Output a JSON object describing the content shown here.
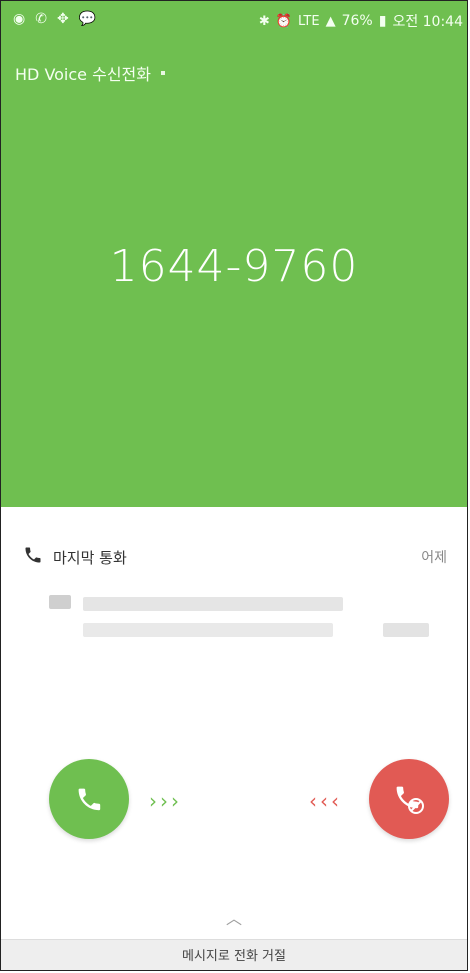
{
  "status_bar": {
    "left_icons": [
      "app-icon",
      "phone-call-icon",
      "location-icon",
      "chat-icon"
    ],
    "bluetooth": "✱",
    "alarm": "⏰",
    "network": "LTE",
    "signal": "▲",
    "battery": "76%",
    "time": "오전 10:44"
  },
  "header": {
    "title": "HD Voice  수신전화"
  },
  "incoming_number": "1644-9760",
  "recent": {
    "label": "마지막 통화",
    "when": "어제"
  },
  "actions": {
    "answer_icon": "phone-icon",
    "decline_icon": "decline-icon",
    "swipe_right": "›››",
    "swipe_left": "‹‹‹"
  },
  "reject_with_message": "메시지로 전화 거절",
  "colors": {
    "accept": "#6fbf50",
    "decline": "#e15a54"
  }
}
